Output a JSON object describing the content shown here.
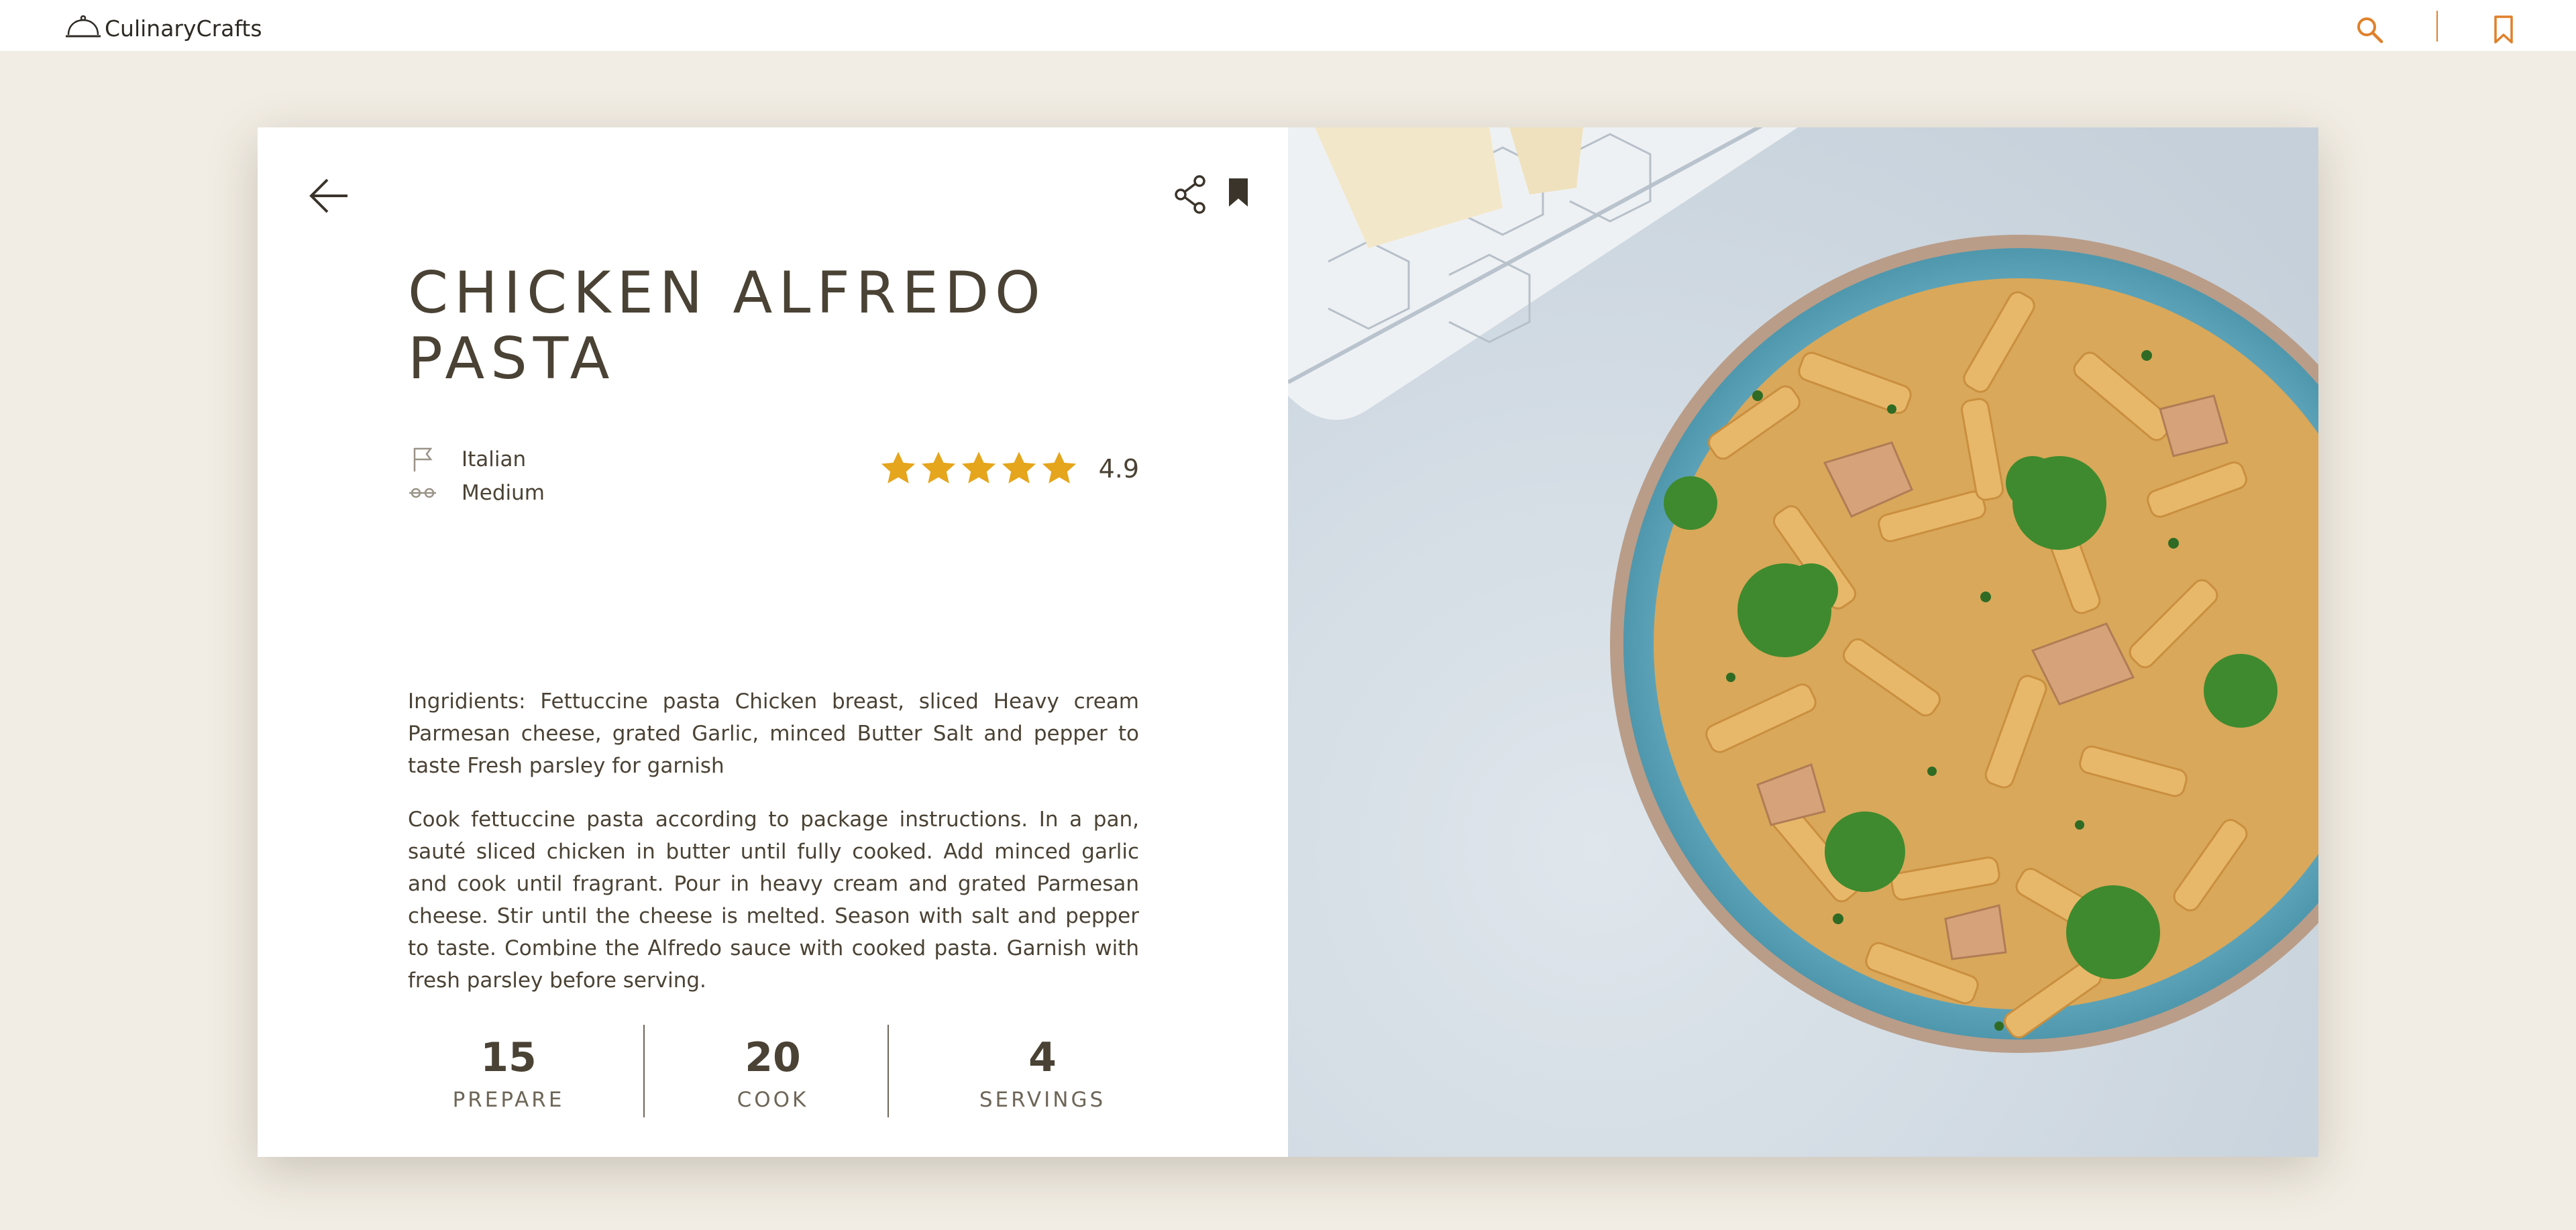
{
  "nav": {
    "brand": "CulinaryCrafts",
    "icons": {
      "logo": "cloche-icon",
      "search": "search-icon",
      "bookmark": "bookmark-icon"
    },
    "accent_color": "#e0802a"
  },
  "recipe": {
    "title": "CHICKEN ALFREDO PASTA",
    "cuisine": "Italian",
    "difficulty": "Medium",
    "rating": {
      "value": "4.9",
      "stars": 5,
      "color": "#e5a51c"
    },
    "ingredients": "Ingridients: Fettuccine pasta Chicken breast, sliced Heavy cream Parmesan cheese, grated Garlic, minced Butter Salt and pepper to taste Fresh parsley for garnish",
    "instructions": "Cook fettuccine pasta according to package instructions. In a pan, sauté sliced chicken in butter until fully cooked. Add minced garlic and cook until fragrant. Pour in heavy cream and grated Parmesan cheese. Stir until the cheese is melted. Season with salt and pepper to taste. Combine the Alfredo sauce with cooked pasta. Garnish with fresh parsley before serving.",
    "stats": [
      {
        "value": "15",
        "label": "PREPARE"
      },
      {
        "value": "20",
        "label": "COOK"
      },
      {
        "value": "4",
        "label": "SERVINGS"
      }
    ]
  },
  "card_icons": {
    "back": "arrow-left-icon",
    "share": "share-icon",
    "save": "bookmark-filled-icon",
    "cuisine": "flag-icon",
    "difficulty": "difficulty-icon"
  },
  "text_color": "#4a4234",
  "background_color": "#f2ede4"
}
